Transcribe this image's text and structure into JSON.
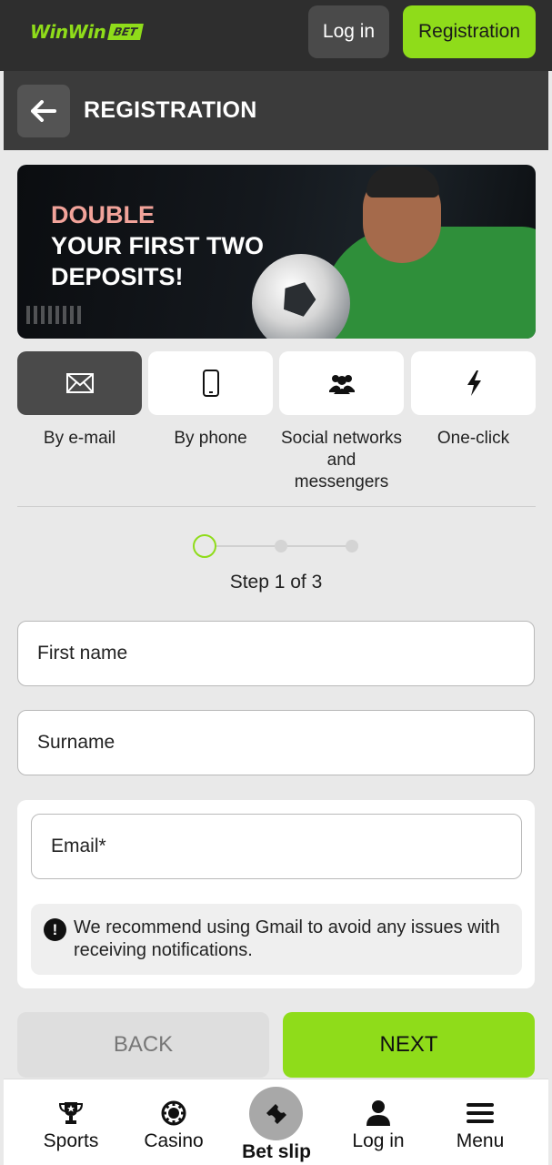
{
  "header": {
    "logo_text": "WinWin",
    "logo_badge": "BET",
    "login_label": "Log in",
    "registration_label": "Registration"
  },
  "titlebar": {
    "title": "REGISTRATION",
    "back_icon": "arrow-left-icon"
  },
  "banner": {
    "highlight": "DOUBLE",
    "line2": "YOUR FIRST TWO",
    "line3": "DEPOSITS!"
  },
  "methods": [
    {
      "label": "By e-mail",
      "icon": "envelope-icon",
      "active": true
    },
    {
      "label": "By phone",
      "icon": "phone-icon",
      "active": false
    },
    {
      "label": "Social networks and messengers",
      "icon": "users-icon",
      "active": false
    },
    {
      "label": "One-click",
      "icon": "lightning-icon",
      "active": false
    }
  ],
  "stepper": {
    "current": 1,
    "total": 3,
    "text": "Step 1 of 3"
  },
  "form": {
    "first_name_placeholder": "First name",
    "surname_placeholder": "Surname",
    "email_placeholder": "Email*",
    "notice": "We recommend using Gmail to avoid any issues with receiving notifications."
  },
  "actions": {
    "back_label": "BACK",
    "next_label": "NEXT"
  },
  "bottom_nav": [
    {
      "label": "Sports",
      "icon": "trophy-icon"
    },
    {
      "label": "Casino",
      "icon": "casino-chip-icon"
    },
    {
      "label": "Bet slip",
      "icon": "ticket-icon"
    },
    {
      "label": "Log in",
      "icon": "user-icon"
    },
    {
      "label": "Menu",
      "icon": "menu-icon"
    }
  ],
  "colors": {
    "accent": "#8fdc1a",
    "topbar": "#2e2e2e",
    "titlebar": "#3b3b3b",
    "banner_highlight": "#f2a39a"
  }
}
